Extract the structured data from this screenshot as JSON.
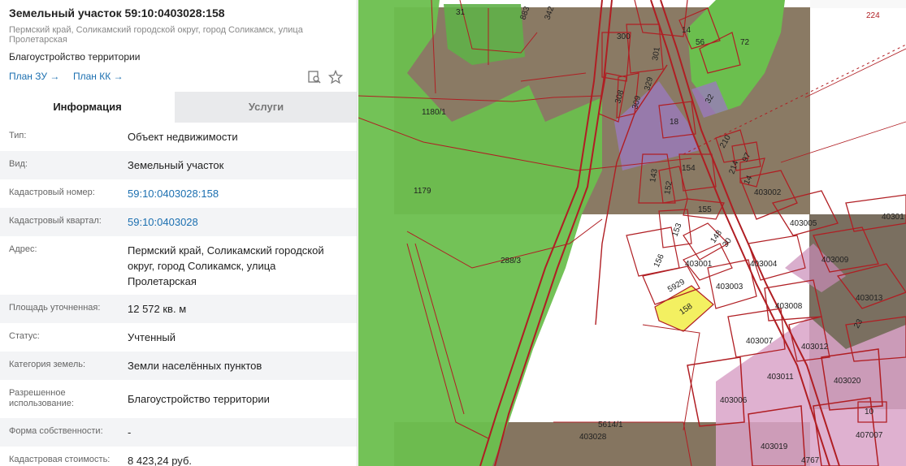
{
  "header": {
    "title": "Земельный участок 59:10:0403028:158",
    "address_line1": "Пермский край, Соликамский городской округ, город Соликамск, улица",
    "address_line2": "Пролетарская",
    "usage": "Благоустройство территории",
    "plan_zu_label": "План ЗУ →",
    "plan_kk_label": "План КК →",
    "icons": [
      "search-document-icon",
      "star-icon"
    ]
  },
  "tabs": [
    {
      "label": "Информация",
      "active": true
    },
    {
      "label": "Услуги",
      "active": false
    }
  ],
  "info_rows": [
    {
      "label": "Тип:",
      "value": "Объект недвижимости"
    },
    {
      "label": "Вид:",
      "value": "Земельный участок"
    },
    {
      "label": "Кадастровый номер:",
      "value": "59:10:0403028:158",
      "link": true
    },
    {
      "label": "Кадастровый квартал:",
      "value": "59:10:0403028",
      "link": true
    },
    {
      "label": "Адрес:",
      "value": "Пермский край, Соликамский городской округ, город Соликамск, улица Пролетарская"
    },
    {
      "label": "Площадь уточненная:",
      "value": "12 572 кв. м"
    },
    {
      "label": "Статус:",
      "value": "Учтенный"
    },
    {
      "label": "Категория земель:",
      "value": "Земли населённых пунктов"
    },
    {
      "label": "Разрешенное использование:",
      "value": "Благоустройство территории"
    },
    {
      "label": "Форма собственности:",
      "value": "-"
    },
    {
      "label": "Кадастровая стоимость:",
      "value": "8 423,24 руб."
    }
  ],
  "map": {
    "parcel_labels": [
      "31",
      "883",
      "342",
      "300",
      "301",
      "329",
      "308",
      "309",
      "14",
      "56",
      "72",
      "32",
      "18",
      "1180/1",
      "210",
      "97",
      "214",
      "143",
      "152",
      "154",
      "14",
      "403002",
      "1179",
      "155",
      "403005",
      "40301",
      "153",
      "148",
      "30",
      "156",
      "403001",
      "403004",
      "403009",
      "288/3",
      "5929",
      "403003",
      "158",
      "403013",
      "403008",
      "23",
      "403007",
      "403012",
      "403011",
      "403020",
      "403006",
      "5614/1",
      "403028",
      "403019",
      "4767",
      "407007",
      "10",
      "224"
    ],
    "colors": {
      "parcel_line": "#b01e23",
      "forest": "#6bbf4e",
      "selected": "#f3f061",
      "urban": "#d9a3c8",
      "purple_zone": "#9a7bbd"
    }
  }
}
